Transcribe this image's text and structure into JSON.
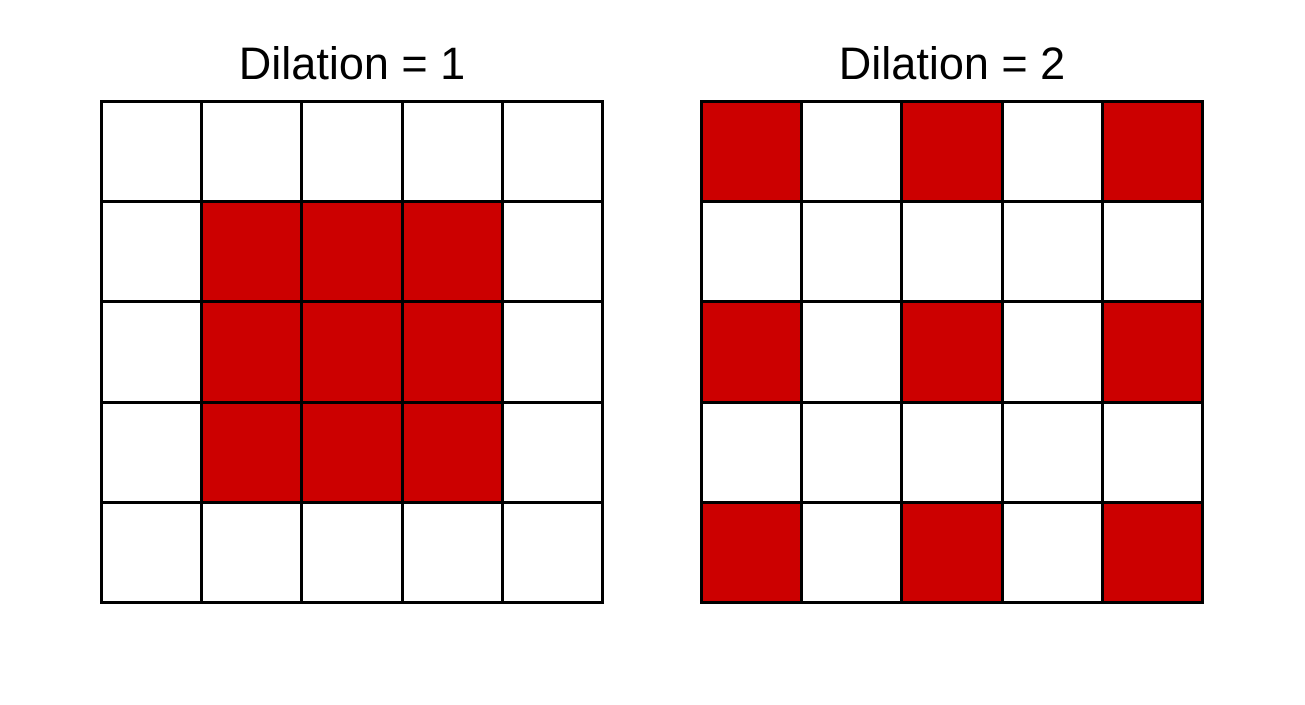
{
  "colors": {
    "active": "#cc0000",
    "inactive": "#ffffff",
    "grid_line": "#000000"
  },
  "panels": [
    {
      "title": "Dilation = 1",
      "cells": [
        [
          0,
          0,
          0,
          0,
          0
        ],
        [
          0,
          1,
          1,
          1,
          0
        ],
        [
          0,
          1,
          1,
          1,
          0
        ],
        [
          0,
          1,
          1,
          1,
          0
        ],
        [
          0,
          0,
          0,
          0,
          0
        ]
      ]
    },
    {
      "title": "Dilation = 2",
      "cells": [
        [
          1,
          0,
          1,
          0,
          1
        ],
        [
          0,
          0,
          0,
          0,
          0
        ],
        [
          1,
          0,
          1,
          0,
          1
        ],
        [
          0,
          0,
          0,
          0,
          0
        ],
        [
          1,
          0,
          1,
          0,
          1
        ]
      ]
    }
  ]
}
